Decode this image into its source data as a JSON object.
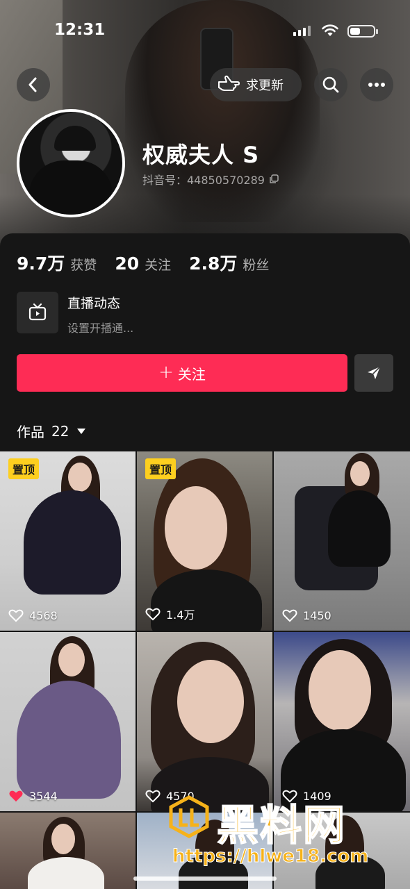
{
  "status_bar": {
    "time": "12:31"
  },
  "nav": {
    "request_update_label": "求更新"
  },
  "profile": {
    "nickname": "权威夫人 S",
    "douyin_id": "抖音号：44850570289"
  },
  "stats": [
    {
      "value": "9.7万",
      "label": "获赞"
    },
    {
      "value": "20",
      "label": "关注"
    },
    {
      "value": "2.8万",
      "label": "粉丝"
    }
  ],
  "live": {
    "title": "直播动态",
    "subtitle": "设置开播通..."
  },
  "actions": {
    "follow_label": "关注"
  },
  "works": {
    "label": "作品",
    "count": "22"
  },
  "grid": [
    {
      "pinned": "置顶",
      "likes": "4568",
      "liked": false
    },
    {
      "pinned": "置顶",
      "likes": "1.4万",
      "liked": false
    },
    {
      "pinned": "",
      "likes": "1450",
      "liked": false
    },
    {
      "pinned": "",
      "likes": "3544",
      "liked": true
    },
    {
      "pinned": "",
      "likes": "4570",
      "liked": false
    },
    {
      "pinned": "",
      "likes": "1409",
      "liked": false
    }
  ],
  "watermark": {
    "title": "黑料网",
    "url": "https://hlwe18.com"
  },
  "colors": {
    "accent": "#fe2c55",
    "pin": "#fdcf1f",
    "watermark": "#f6b21a"
  }
}
